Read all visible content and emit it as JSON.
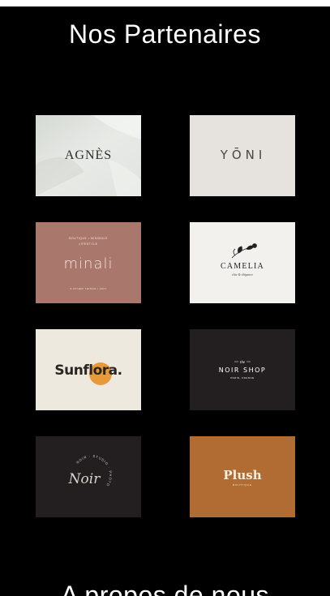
{
  "section": {
    "title": "Nos Partenaires"
  },
  "partners": [
    {
      "name": "AGNÈS",
      "bg": "#e3e6e1",
      "fg": "#2d2d2d"
    },
    {
      "name": "YŌNI",
      "bg": "#e6e3de",
      "fg": "#4a4845"
    },
    {
      "name": "minali",
      "small_top": "BOUTIQUE • MINIMALE",
      "small_top2": "LIFESTYLE",
      "small_bottom": "& OTHER THINGS • 2021",
      "bg": "#a9776b",
      "fg": "#f3e6e0"
    },
    {
      "name": "CAMELIA",
      "tagline": "chic & élégance",
      "bg": "#f3f1ee",
      "fg": "#222222"
    },
    {
      "name": "Sunflora.",
      "bg": "#eee9df",
      "fg": "#2b2521",
      "accent": "#e79a3c"
    },
    {
      "name": "NOIR SHOP",
      "small_top": "the",
      "small_bottom": "PARIS, FRANCE",
      "bg": "#231f20",
      "fg": "#ffffff"
    },
    {
      "name": "Noir",
      "arc": "NOIR · STUDIO · PHOTO",
      "bg": "#231f20",
      "fg": "#d9d4cf"
    },
    {
      "name": "Plush",
      "small_bottom": "BOUTIQUE",
      "bg": "#b06c32",
      "fg": "#fbeee2"
    }
  ],
  "about": {
    "title": "A propos de nous"
  },
  "colors": {
    "background": "#000000",
    "text": "#ffffff",
    "top_strip": "#ffffff"
  }
}
